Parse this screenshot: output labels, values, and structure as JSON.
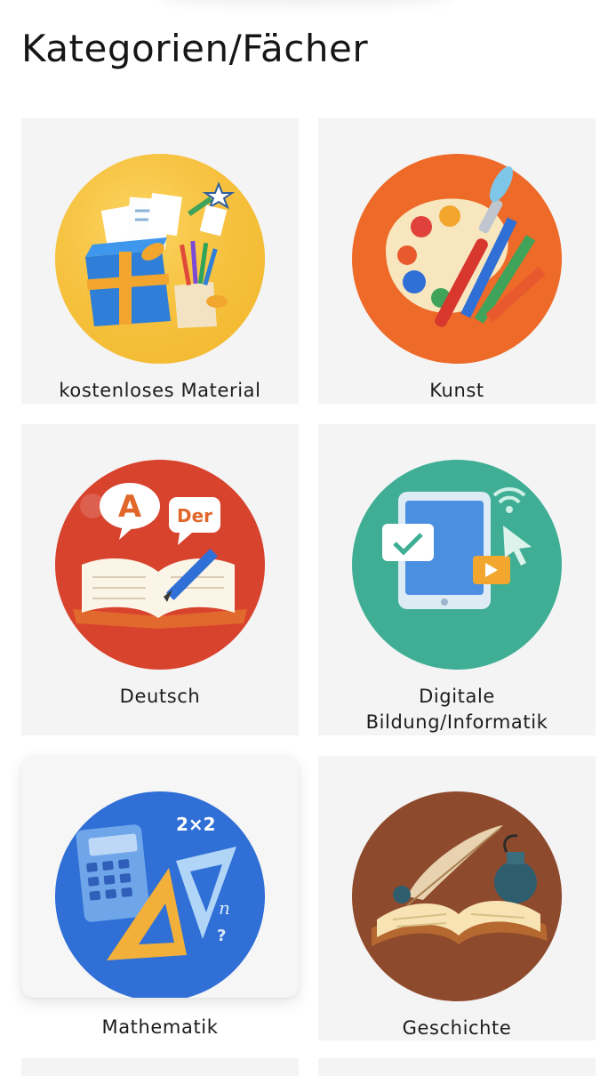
{
  "page": {
    "title": "Kategorien/Fächer"
  },
  "categories": [
    {
      "label": "kostenloses Material",
      "icon": "gift-box-with-papers-icon",
      "color": "#F6C437"
    },
    {
      "label": "Kunst",
      "icon": "paint-palette-icon",
      "color": "#EE6A28"
    },
    {
      "label": "Deutsch",
      "icon": "open-book-speech-bubbles-icon",
      "color": "#D8432E",
      "bubble_a": "A",
      "bubble_der": "Der"
    },
    {
      "label": "Digitale",
      "label_line2": "Bildung/Informatik",
      "icon": "tablet-cursor-icon",
      "color": "#3FAE95"
    },
    {
      "label": "Mathematik",
      "icon": "calculator-triangle-ruler-icon",
      "color": "#2F6FD6",
      "math_text": "2×2",
      "math_n": "n",
      "math_q": "?"
    },
    {
      "label": "Geschichte",
      "icon": "quill-book-inkwell-icon",
      "color": "#8E4A2C"
    }
  ]
}
